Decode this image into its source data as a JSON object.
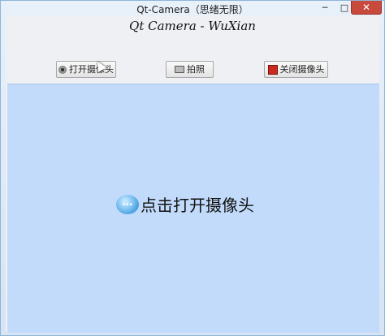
{
  "window": {
    "title": "Qt-Camera（思绪无限）",
    "minimize_glyph": "─",
    "maximize_glyph": "□",
    "close_glyph": "✕"
  },
  "app": {
    "heading": "Qt Camera - WuXian"
  },
  "toolbar": {
    "open_camera_label": "打开摄像头",
    "capture_label": "拍照",
    "close_camera_label": "关闭摄像头"
  },
  "viewport": {
    "hint_text": "点击打开摄像头",
    "bubble_glyph": "…",
    "background": "#c2dbfb"
  },
  "icons": {
    "open_camera": "webcam-icon",
    "capture": "camera-icon",
    "close_camera": "stop-icon",
    "hint": "chat-bubble-icon"
  }
}
